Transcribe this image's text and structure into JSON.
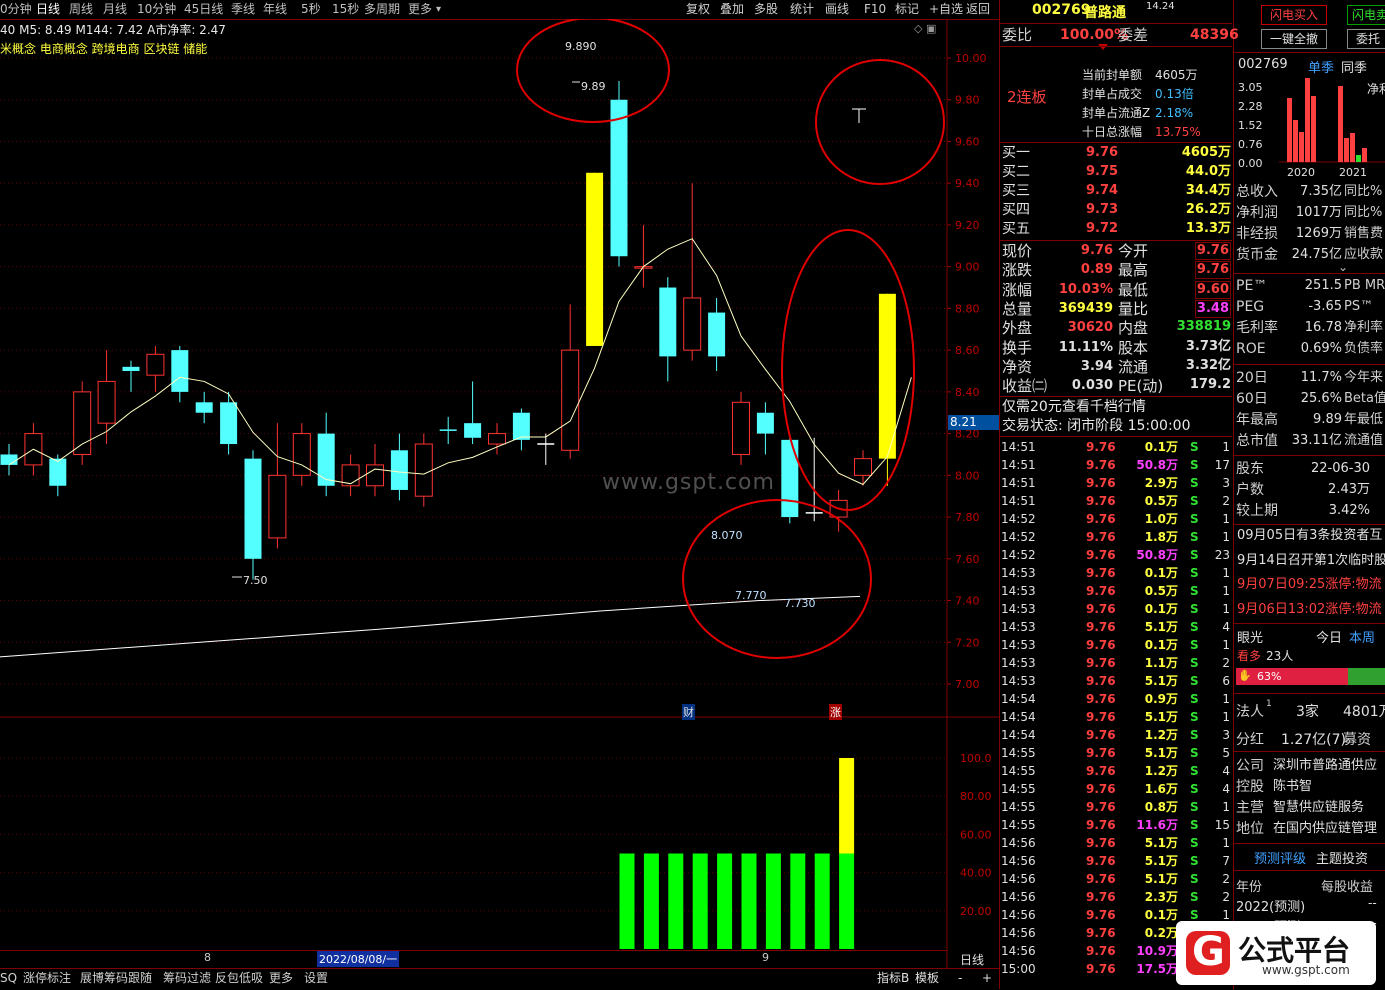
{
  "toolbar": {
    "periods": [
      "0分钟",
      "日线",
      "周线",
      "月线",
      "10分钟",
      "45日线",
      "季线",
      "年线",
      "5秒",
      "15秒",
      "多周期",
      "更多"
    ],
    "actions": [
      "复权",
      "叠加",
      "多股",
      "统计",
      "画线",
      "F10",
      "标记",
      "+自选",
      "返回"
    ]
  },
  "chart": {
    "ma_line": "40  M5: 8.49  M144: 7.42  A市净率: 2.47",
    "concepts": "米概念 电商概念 跨境电商 区块链 储能",
    "watermark": "www.gspt.com",
    "price_labels": [
      "10.00",
      "9.80",
      "9.60",
      "9.40",
      "9.20",
      "9.00",
      "8.80",
      "8.60",
      "8.40",
      "8.20",
      "8.00",
      "7.80",
      "7.60",
      "7.40",
      "7.20",
      "7.00"
    ],
    "current_price_tag": "8.21",
    "annotations": {
      "high_box": "9.890",
      "high_mark": "9.89",
      "low_mark": "7.50",
      "mark_8070": "8.070",
      "mark_7770": "7.770",
      "mark_7730": "7.730"
    },
    "markers": {
      "cai": "财",
      "zhang": "涨"
    },
    "volume_labels": [
      "100.0",
      "80.00",
      "60.00",
      "40.00",
      "20.00"
    ],
    "date_axis": {
      "left": "8",
      "date": "2022/08/08/一",
      "right": "9"
    },
    "axis_label": "日线"
  },
  "chart_data": {
    "type": "candlestick",
    "ylim": [
      7.0,
      10.0
    ],
    "candles": [
      {
        "o": 8.1,
        "c": 8.05,
        "h": 8.15,
        "l": 8.0,
        "color": "cyan"
      },
      {
        "o": 8.05,
        "c": 8.2,
        "h": 8.25,
        "l": 8.0,
        "color": "red"
      },
      {
        "o": 8.08,
        "c": 7.95,
        "h": 8.1,
        "l": 7.9,
        "color": "cyan"
      },
      {
        "o": 8.1,
        "c": 8.4,
        "h": 8.45,
        "l": 8.05,
        "color": "red"
      },
      {
        "o": 8.25,
        "c": 8.45,
        "h": 8.6,
        "l": 8.15,
        "color": "red"
      },
      {
        "o": 8.5,
        "c": 8.52,
        "h": 8.55,
        "l": 8.4,
        "color": "cyan"
      },
      {
        "o": 8.48,
        "c": 8.58,
        "h": 8.62,
        "l": 8.4,
        "color": "red"
      },
      {
        "o": 8.6,
        "c": 8.4,
        "h": 8.62,
        "l": 8.35,
        "color": "cyan"
      },
      {
        "o": 8.35,
        "c": 8.3,
        "h": 8.4,
        "l": 8.25,
        "color": "cyan"
      },
      {
        "o": 8.35,
        "c": 8.15,
        "h": 8.4,
        "l": 8.1,
        "color": "cyan"
      },
      {
        "o": 8.08,
        "c": 7.6,
        "h": 8.12,
        "l": 7.5,
        "color": "cyan"
      },
      {
        "o": 7.7,
        "c": 8.0,
        "h": 8.25,
        "l": 7.65,
        "color": "red"
      },
      {
        "o": 8.0,
        "c": 8.2,
        "h": 8.25,
        "l": 7.95,
        "color": "red"
      },
      {
        "o": 8.2,
        "c": 7.95,
        "h": 8.3,
        "l": 7.9,
        "color": "cyan"
      },
      {
        "o": 7.95,
        "c": 8.05,
        "h": 8.1,
        "l": 7.9,
        "color": "red"
      },
      {
        "o": 8.05,
        "c": 7.95,
        "h": 8.15,
        "l": 7.9,
        "color": "red"
      },
      {
        "o": 8.12,
        "c": 7.93,
        "h": 8.2,
        "l": 7.88,
        "color": "cyan"
      },
      {
        "o": 7.9,
        "c": 8.15,
        "h": 8.2,
        "l": 7.85,
        "color": "red"
      },
      {
        "o": 8.22,
        "c": 8.22,
        "h": 8.28,
        "l": 8.15,
        "color": "cyan"
      },
      {
        "o": 8.25,
        "c": 8.18,
        "h": 8.45,
        "l": 8.15,
        "color": "cyan"
      },
      {
        "o": 8.15,
        "c": 8.2,
        "h": 8.25,
        "l": 8.1,
        "color": "red"
      },
      {
        "o": 8.3,
        "c": 8.17,
        "h": 8.32,
        "l": 8.12,
        "color": "cyan"
      },
      {
        "o": 8.15,
        "c": 8.15,
        "h": 8.2,
        "l": 8.05,
        "color": "white"
      },
      {
        "o": 8.12,
        "c": 8.6,
        "h": 8.82,
        "l": 8.08,
        "color": "red"
      },
      {
        "o": 8.62,
        "c": 9.45,
        "h": 9.45,
        "l": 8.62,
        "color": "yellow"
      },
      {
        "o": 9.05,
        "c": 9.8,
        "h": 9.89,
        "l": 9.0,
        "color": "cyan"
      },
      {
        "o": 9.0,
        "c": 9.0,
        "h": 9.2,
        "l": 8.9,
        "color": "red"
      },
      {
        "o": 8.9,
        "c": 8.57,
        "h": 8.95,
        "l": 8.45,
        "color": "cyan"
      },
      {
        "o": 8.6,
        "c": 8.85,
        "h": 9.4,
        "l": 8.55,
        "color": "red"
      },
      {
        "o": 8.78,
        "c": 8.57,
        "h": 8.85,
        "l": 8.5,
        "color": "cyan"
      },
      {
        "o": 8.1,
        "c": 8.35,
        "h": 8.4,
        "l": 8.05,
        "color": "red"
      },
      {
        "o": 8.3,
        "c": 8.2,
        "h": 8.35,
        "l": 8.1,
        "color": "cyan"
      },
      {
        "o": 8.17,
        "c": 7.8,
        "h": 8.2,
        "l": 7.77,
        "color": "cyan"
      },
      {
        "o": 7.82,
        "c": 7.82,
        "h": 8.18,
        "l": 7.78,
        "color": "white"
      },
      {
        "o": 7.8,
        "c": 7.88,
        "h": 7.93,
        "l": 7.73,
        "color": "red"
      },
      {
        "o": 8.0,
        "c": 8.08,
        "h": 8.12,
        "l": 7.95,
        "color": "red"
      },
      {
        "o": 8.08,
        "c": 8.87,
        "h": 8.87,
        "l": 7.95,
        "color": "yellow"
      }
    ],
    "volume_bars": [
      {
        "index": 25,
        "value": 50
      },
      {
        "index": 26,
        "value": 50
      },
      {
        "index": 27,
        "value": 50
      },
      {
        "index": 28,
        "value": 50
      },
      {
        "index": 29,
        "value": 50
      },
      {
        "index": 30,
        "value": 50
      },
      {
        "index": 31,
        "value": 50
      },
      {
        "index": 32,
        "value": 50
      },
      {
        "index": 33,
        "value": 50
      },
      {
        "index": 34,
        "value": 50,
        "extra": 50
      }
    ]
  },
  "quote": {
    "code": "002769",
    "name": "普路通",
    "badge": "14.24",
    "wei_bi_label": "委比",
    "wei_bi": "100.00%",
    "wei_cha_label": "委差",
    "wei_cha": "48396",
    "streak": "2连板",
    "seal": [
      {
        "k": "当前封单额",
        "v": "4605万"
      },
      {
        "k": "封单占成交",
        "v": "0.13倍"
      },
      {
        "k": "封单占流通Z",
        "v": "2.18%"
      },
      {
        "k": "十日总涨幅",
        "v": "13.75%"
      }
    ],
    "bids": [
      {
        "name": "买一",
        "price": "9.76",
        "vol": "4605万"
      },
      {
        "name": "买二",
        "price": "9.75",
        "vol": "44.0万"
      },
      {
        "name": "买三",
        "price": "9.74",
        "vol": "34.4万"
      },
      {
        "name": "买四",
        "price": "9.73",
        "vol": "26.2万"
      },
      {
        "name": "买五",
        "price": "9.72",
        "vol": "13.3万"
      }
    ],
    "stats_left": [
      {
        "k": "现价",
        "v": "9.76"
      },
      {
        "k": "涨跌",
        "v": "0.89"
      },
      {
        "k": "涨幅",
        "v": "10.03%"
      },
      {
        "k": "总量",
        "v": "369439"
      },
      {
        "k": "外盘",
        "v": "30620"
      },
      {
        "k": "换手",
        "v": "11.11%"
      },
      {
        "k": "净资",
        "v": "3.94"
      },
      {
        "k": "收益㈡",
        "v": "0.030"
      }
    ],
    "stats_right": [
      {
        "k": "今开",
        "v": "9.76"
      },
      {
        "k": "最高",
        "v": "9.76"
      },
      {
        "k": "最低",
        "v": "9.60"
      },
      {
        "k": "量比",
        "v": "3.48"
      },
      {
        "k": "内盘",
        "v": "338819"
      },
      {
        "k": "股本",
        "v": "3.73亿"
      },
      {
        "k": "流通",
        "v": "3.32亿"
      },
      {
        "k": "PE(动)",
        "v": "179.2"
      }
    ],
    "promo": "仅需20元查看千档行情",
    "trade_state": "交易状态: 闭市阶段 15:00:00"
  },
  "ticks": [
    [
      "14:51",
      "9.76",
      "0.1万",
      "S",
      "1"
    ],
    [
      "14:51",
      "9.76",
      "50.8万",
      "S",
      "17"
    ],
    [
      "14:51",
      "9.76",
      "2.9万",
      "S",
      "3"
    ],
    [
      "14:51",
      "9.76",
      "0.5万",
      "S",
      "2"
    ],
    [
      "14:52",
      "9.76",
      "1.0万",
      "S",
      "1"
    ],
    [
      "14:52",
      "9.76",
      "1.8万",
      "S",
      "1"
    ],
    [
      "14:52",
      "9.76",
      "50.8万",
      "S",
      "23"
    ],
    [
      "14:53",
      "9.76",
      "0.1万",
      "S",
      "1"
    ],
    [
      "14:53",
      "9.76",
      "0.5万",
      "S",
      "1"
    ],
    [
      "14:53",
      "9.76",
      "0.1万",
      "S",
      "1"
    ],
    [
      "14:53",
      "9.76",
      "5.1万",
      "S",
      "4"
    ],
    [
      "14:53",
      "9.76",
      "0.1万",
      "S",
      "1"
    ],
    [
      "14:53",
      "9.76",
      "1.1万",
      "S",
      "2"
    ],
    [
      "14:53",
      "9.76",
      "5.1万",
      "S",
      "6"
    ],
    [
      "14:54",
      "9.76",
      "0.9万",
      "S",
      "1"
    ],
    [
      "14:54",
      "9.76",
      "5.1万",
      "S",
      "1"
    ],
    [
      "14:54",
      "9.76",
      "1.2万",
      "S",
      "3"
    ],
    [
      "14:55",
      "9.76",
      "5.1万",
      "S",
      "5"
    ],
    [
      "14:55",
      "9.76",
      "1.2万",
      "S",
      "4"
    ],
    [
      "14:55",
      "9.76",
      "1.6万",
      "S",
      "4"
    ],
    [
      "14:55",
      "9.76",
      "0.8万",
      "S",
      "1"
    ],
    [
      "14:55",
      "9.76",
      "11.6万",
      "S",
      "15"
    ],
    [
      "14:56",
      "9.76",
      "5.1万",
      "S",
      "1"
    ],
    [
      "14:56",
      "9.76",
      "5.1万",
      "S",
      "7"
    ],
    [
      "14:56",
      "9.76",
      "5.1万",
      "S",
      "2"
    ],
    [
      "14:56",
      "9.76",
      "2.3万",
      "S",
      "2"
    ],
    [
      "14:56",
      "9.76",
      "0.1万",
      "S",
      "1"
    ],
    [
      "14:56",
      "9.76",
      "0.2万",
      "S",
      ""
    ],
    [
      "14:56",
      "9.76",
      "10.9万",
      "S",
      ""
    ],
    [
      "15:00",
      "9.76",
      "17.5万",
      "S",
      ""
    ]
  ],
  "side": {
    "buttons": [
      "闪电买入",
      "闪电卖",
      "一键全撤",
      "委托"
    ],
    "code": "002769",
    "tabs": [
      "单季",
      "同季",
      "净利"
    ],
    "bar_chart": {
      "ylabels": [
        "3.05",
        "2.28",
        "1.52",
        "0.76",
        "0.00"
      ],
      "years": [
        "2020",
        "2021"
      ]
    },
    "fin": [
      {
        "k": "总收入",
        "v": "7.35亿",
        "r": "同比%"
      },
      {
        "k": "净利润",
        "v": "1017万",
        "r": "同比%"
      },
      {
        "k": "非经损",
        "v": "1269万",
        "r": "销售费"
      },
      {
        "k": "货币金",
        "v": "24.75亿",
        "r": "应收款"
      }
    ],
    "val": [
      {
        "k": "PE™",
        "v": "251.5",
        "r": "PB MRQ"
      },
      {
        "k": "PEG",
        "v": "-3.65",
        "r": "PS™"
      },
      {
        "k": "毛利率",
        "v": "16.78",
        "r": "净利率"
      },
      {
        "k": "ROE",
        "v": "0.69%",
        "r": "负债率"
      }
    ],
    "perf": [
      {
        "k": "20日",
        "v": "11.7%",
        "r": "今年来"
      },
      {
        "k": "60日",
        "v": "25.6%",
        "r": "Beta值"
      },
      {
        "k": "年最高",
        "v": "9.89",
        "r": "年最低"
      },
      {
        "k": "总市值",
        "v": "33.11亿",
        "r": "流通值"
      }
    ],
    "holders": [
      {
        "k": "股东",
        "v": "22-06-30"
      },
      {
        "k": "户数",
        "v": "2.43万"
      },
      {
        "k": "较上期",
        "v": "3.42%"
      }
    ],
    "news": [
      "09月05日有3条投资者互",
      "9月14日召开第1次临时股",
      "9月07日09:25涨停:物流",
      "9月06日13:02涨停:物流"
    ],
    "eye": {
      "title": "眼光",
      "today": "今日",
      "week": "本周",
      "bull": "看多",
      "count": "23人",
      "pct": "63%"
    },
    "org": {
      "k": "法人",
      "sup": "1",
      "v1": "3家",
      "v2": "4801万"
    },
    "dist": {
      "k": "分红",
      "v": "1.27亿(7)",
      "r": "募资"
    },
    "company": [
      {
        "k": "公司",
        "v": "深圳市普路通供应"
      },
      {
        "k": "控股",
        "v": "陈书智"
      },
      {
        "k": "主营",
        "v": "智慧供应链服务"
      },
      {
        "k": "地位",
        "v": "在国内供应链管理"
      }
    ],
    "forecast": {
      "tab1": "预测评级",
      "tab2": "主题投资",
      "col1": "年份",
      "col2": "每股收益",
      "rows": [
        "2022(预测)",
        "2023(预测)"
      ]
    },
    "brand": {
      "name": "公式平台",
      "url": "www.gspt.com"
    }
  },
  "bottom_bar": {
    "left": [
      "SQ",
      "涨停标注",
      "展博筹码跟随",
      "筹码过滤",
      "反包低吸",
      "更多",
      "设置"
    ],
    "right": [
      "指标B",
      "模板",
      "-",
      "+"
    ]
  }
}
